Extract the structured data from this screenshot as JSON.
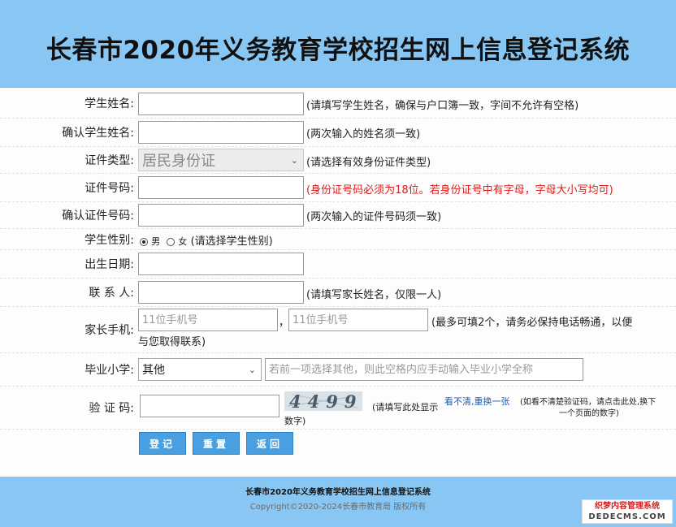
{
  "header": {
    "title": "长春市2020年义务教育学校招生网上信息登记系统"
  },
  "form": {
    "student_name": {
      "label": "学生姓名:",
      "value": "",
      "hint": "(请填写学生姓名，确保与户口簿一致，字间不允许有空格)"
    },
    "confirm_name": {
      "label": "确认学生姓名:",
      "value": "",
      "hint": "(两次输入的姓名须一致)"
    },
    "id_type": {
      "label": "证件类型:",
      "selected": "居民身份证",
      "hint": "(请选择有效身份证件类型)"
    },
    "id_number": {
      "label": "证件号码:",
      "value": "",
      "hint": "(身份证号码必须为18位。若身份证号中有字母，字母大小写均可)"
    },
    "confirm_id": {
      "label": "确认证件号码:",
      "value": "",
      "hint": "(两次输入的证件号码须一致)"
    },
    "gender": {
      "label": "学生性别:",
      "male": "男",
      "female": "女",
      "hint": "(请选择学生性别)"
    },
    "birth_date": {
      "label": "出生日期:",
      "value": ""
    },
    "contact": {
      "label": "联 系 人:",
      "value": "",
      "hint": "(请填写家长姓名，仅限一人)"
    },
    "parent_phone": {
      "label": "家长手机:",
      "placeholder1": "11位手机号",
      "separator": "，",
      "placeholder2": "11位手机号",
      "hint_line1": "(最多可填2个，请务必保持电话畅通，以便",
      "hint_line2": "与您取得联系)"
    },
    "school": {
      "label": "毕业小学:",
      "selected": "其他",
      "placeholder": "若前一项选择其他，则此空格内应手动输入毕业小学全称"
    },
    "captcha": {
      "label": "验 证 码:",
      "value": "",
      "image_text": "4499",
      "hint_prefix": "(请填写此处显示",
      "refresh_link": "看不清,重换一张",
      "hint_suffix": "(如看不清楚验证码，请点击此处,换下",
      "hint_line2": "一个页面的数字)",
      "below_image": "数字)"
    },
    "buttons": {
      "submit": "登记",
      "reset": "重置",
      "back": "返回"
    }
  },
  "footer": {
    "title": "长春市2020年义务教育学校招生网上信息登记系统",
    "copyright": "Copyright©2020-2024长春市教育局 版权所有"
  },
  "watermark": {
    "line1": "织梦内容管理系统",
    "line2": "DEDECMS.COM"
  },
  "colors": {
    "header_bg": "#88c7f3",
    "button_bg": "#4a9fe0",
    "error_hint": "#d81e1e"
  }
}
